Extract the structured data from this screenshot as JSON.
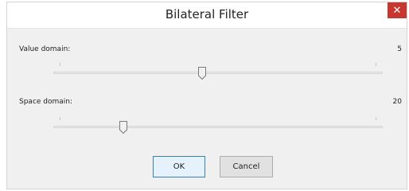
{
  "dialog": {
    "title": "Bilateral Filter",
    "close_glyph": "✕"
  },
  "value_domain": {
    "label": "Value domain:",
    "value": "5",
    "slider_fraction": 0.45
  },
  "space_domain": {
    "label": "Space domain:",
    "value": "20",
    "slider_fraction": 0.2
  },
  "buttons": {
    "ok_label": "OK",
    "cancel_label": "Cancel"
  },
  "colors": {
    "close_button": "#c7372f",
    "dialog_background": "#f0f0f0"
  }
}
